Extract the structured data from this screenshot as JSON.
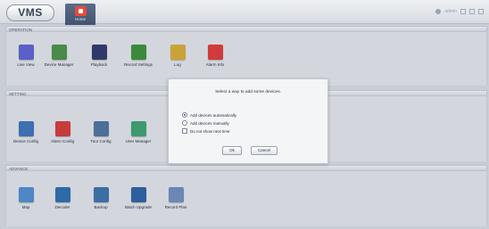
{
  "app": {
    "logo": "VMS",
    "home_tab": "Home"
  },
  "titlebar": {
    "user": "admin"
  },
  "sections": {
    "operation": {
      "title": "OPERATION",
      "items": [
        {
          "label": "Live View",
          "icon": "live-view-icon",
          "color": "#5a5fc9"
        },
        {
          "label": "Device Manager",
          "icon": "device-manager-icon",
          "color": "#4a8a4a"
        },
        {
          "label": "Playback",
          "icon": "playback-icon",
          "color": "#2f3a6b"
        },
        {
          "label": "Record Settings",
          "icon": "record-settings-icon",
          "color": "#3b8a3b"
        },
        {
          "label": "Log",
          "icon": "log-icon",
          "color": "#c9a23a"
        },
        {
          "label": "Alarm Info",
          "icon": "alarm-info-icon",
          "color": "#d23b3b"
        }
      ]
    },
    "setting": {
      "title": "SETTING",
      "items": [
        {
          "label": "Device Config",
          "icon": "device-config-icon",
          "color": "#3e6fb3"
        },
        {
          "label": "Alarm Config",
          "icon": "alarm-config-icon",
          "color": "#c63c3c"
        },
        {
          "label": "Tour Config",
          "icon": "tour-config-icon",
          "color": "#4c6f9b"
        },
        {
          "label": "User Manager",
          "icon": "user-manager-icon",
          "color": "#3c9a6e"
        }
      ]
    },
    "advance": {
      "title": "ADVANCE",
      "items": [
        {
          "label": "Map",
          "icon": "map-icon",
          "color": "#4f86c6"
        },
        {
          "label": "Decoder",
          "icon": "decoder-icon",
          "color": "#2d6aa8"
        },
        {
          "label": "Backup",
          "icon": "backup-icon",
          "color": "#3a6ea5"
        },
        {
          "label": "Batch Upgrade",
          "icon": "batch-upgrade-icon",
          "color": "#2d5f9c"
        },
        {
          "label": "Record Plan",
          "icon": "record-plan-icon",
          "color": "#6b87b6"
        }
      ]
    }
  },
  "dialog": {
    "title": "Select a way to add some devices.",
    "options": [
      {
        "label": "Add devices automatically",
        "selected": true
      },
      {
        "label": "Add devices manually",
        "selected": false
      }
    ],
    "checkbox": "Do not show next time",
    "ok": "Ok",
    "cancel": "Cancel"
  }
}
